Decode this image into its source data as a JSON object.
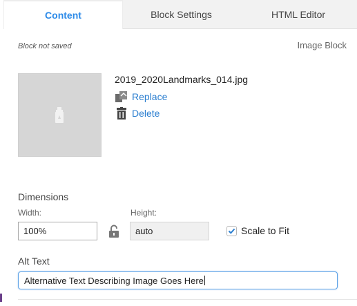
{
  "tabs": [
    {
      "label": "Content",
      "active": true
    },
    {
      "label": "Block Settings",
      "active": false
    },
    {
      "label": "HTML Editor",
      "active": false
    }
  ],
  "status": {
    "save_state": "Block not saved",
    "block_type": "Image Block"
  },
  "image": {
    "filename": "2019_2020Landmarks_014.jpg",
    "replace_label": "Replace",
    "delete_label": "Delete",
    "replace_icon": "replace-image-icon",
    "delete_icon": "trash-icon",
    "placeholder_icon": "image-placeholder-icon"
  },
  "dimensions": {
    "title": "Dimensions",
    "width_label": "Width:",
    "width_value": "100%",
    "height_label": "Height:",
    "height_value": "auto",
    "lock_icon": "unlock-icon",
    "scale_to_fit_label": "Scale to Fit",
    "scale_to_fit_checked": true
  },
  "alt": {
    "title": "Alt Text",
    "value": "Alternative Text Describing Image Goes Here"
  },
  "colors": {
    "accent": "#2c8ae8",
    "link": "#2c7fd0",
    "focus_border": "#5aa0e6"
  }
}
